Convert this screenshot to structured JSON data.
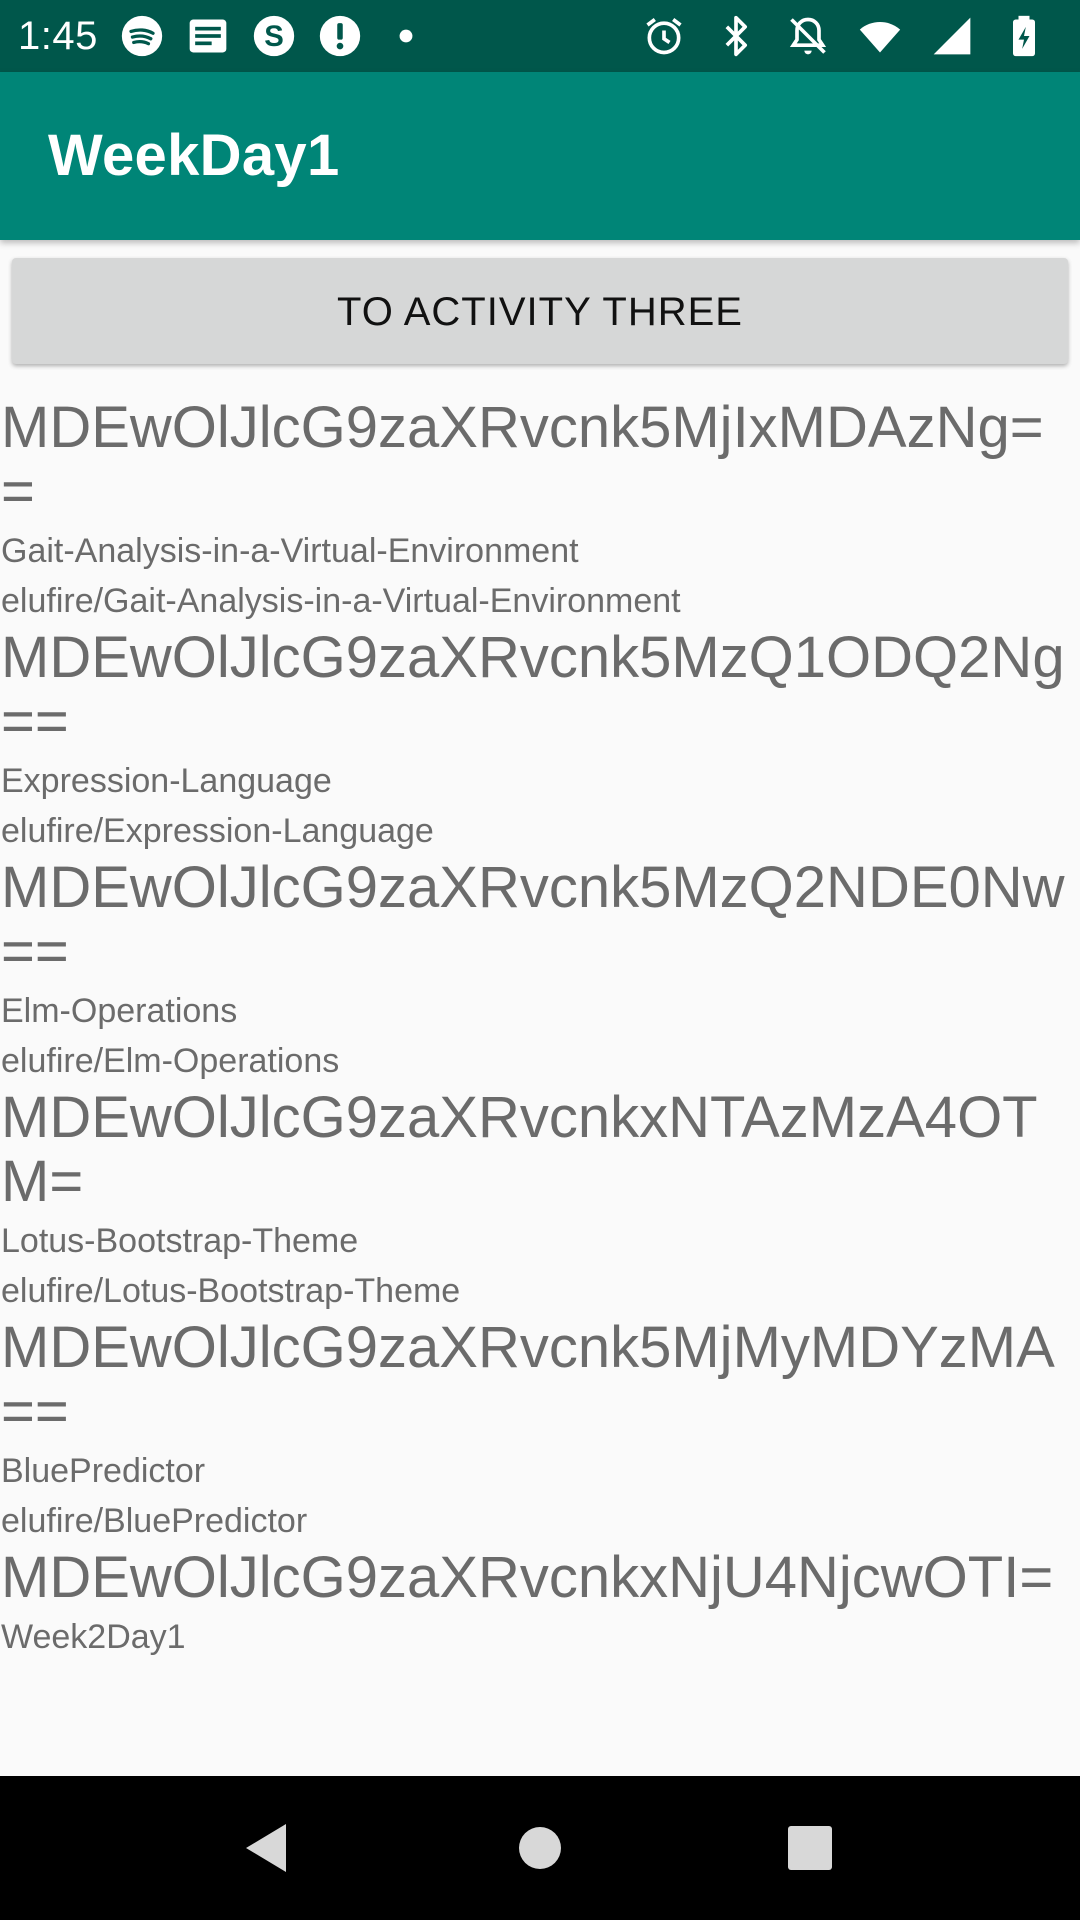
{
  "status_bar": {
    "time": "1:45",
    "left_icons": [
      "spotify-icon",
      "news-icon",
      "skype-icon",
      "alert-icon",
      "dot-icon"
    ],
    "right_icons": [
      "alarm-icon",
      "bluetooth-icon",
      "notifications-off-icon",
      "wifi-icon",
      "signal-icon",
      "battery-charging-icon"
    ]
  },
  "app_bar": {
    "title": "WeekDay1"
  },
  "button": {
    "label": "TO ACTIVITY THREE"
  },
  "repos": [
    {
      "id": "MDEwOlJlcG9zaXRvcnk5MjIxMDAzNg==",
      "name": "Gait-Analysis-in-a-Virtual-Environment",
      "full_name": "elufire/Gait-Analysis-in-a-Virtual-Environment"
    },
    {
      "id": "MDEwOlJlcG9zaXRvcnk5MzQ1ODQ2Ng==",
      "name": "Expression-Language",
      "full_name": "elufire/Expression-Language"
    },
    {
      "id": "MDEwOlJlcG9zaXRvcnk5MzQ2NDE0Nw==",
      "name": "Elm-Operations",
      "full_name": "elufire/Elm-Operations"
    },
    {
      "id": "MDEwOlJlcG9zaXRvcnkxNTAzMzA4OTM=",
      "name": "Lotus-Bootstrap-Theme",
      "full_name": "elufire/Lotus-Bootstrap-Theme"
    },
    {
      "id": "MDEwOlJlcG9zaXRvcnk5MjMyMDYzMA==",
      "name": "BluePredictor",
      "full_name": "elufire/BluePredictor"
    },
    {
      "id": "MDEwOlJlcG9zaXRvcnkxNjU4NjcwOTI=",
      "name": "Week2Day1",
      "full_name": ""
    }
  ],
  "colors": {
    "status_bar": "#00574b",
    "app_bar": "#008577",
    "button": "#d6d7d7",
    "text": "#6b6b6b",
    "background": "#fafafa"
  },
  "nav_bar": {
    "icons": [
      "back-icon",
      "home-icon",
      "recents-icon"
    ]
  }
}
